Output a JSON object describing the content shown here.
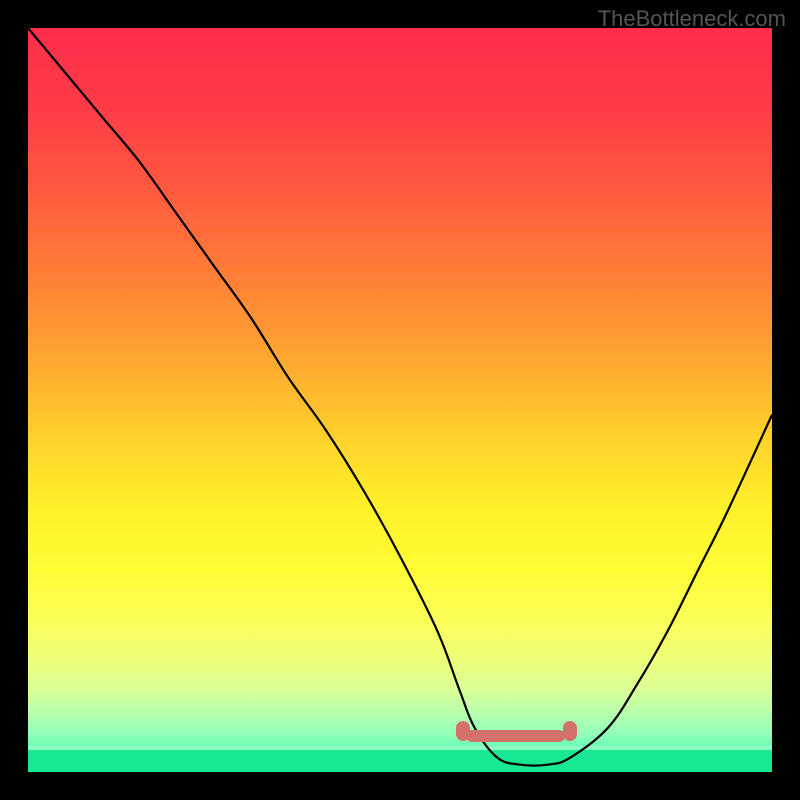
{
  "watermark": "TheBottleneck.com",
  "chart_data": {
    "type": "line",
    "title": "",
    "xlabel": "",
    "ylabel": "",
    "xlim": [
      0,
      100
    ],
    "ylim": [
      0,
      100
    ],
    "series": [
      {
        "name": "curve",
        "x": [
          0,
          5,
          10,
          15,
          20,
          25,
          30,
          35,
          40,
          45,
          50,
          55,
          58,
          60,
          63,
          66,
          70,
          73,
          78,
          82,
          86,
          90,
          94,
          100
        ],
        "values": [
          100,
          94,
          88,
          82,
          75,
          68,
          61,
          53,
          46,
          38,
          29,
          19,
          11,
          6,
          2,
          1,
          1,
          2,
          6,
          12,
          19,
          27,
          35,
          48
        ]
      }
    ],
    "highlight_band": {
      "x_start": 58,
      "x_end": 73,
      "y": 5
    },
    "background_gradient": {
      "top": "#ff2e4a",
      "mid": "#ffd12b",
      "bottom": "#18e892"
    }
  }
}
